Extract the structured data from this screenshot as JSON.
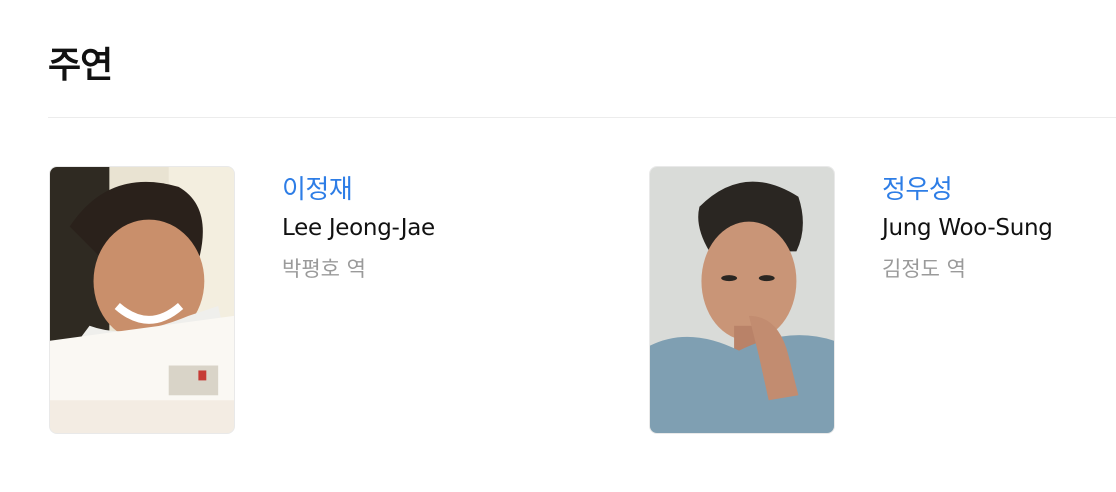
{
  "section": {
    "title": "주연"
  },
  "cast": [
    {
      "korean_name": "이정재",
      "english_name": "Lee Jeong-Jae",
      "role": "박평호 역"
    },
    {
      "korean_name": "정우성",
      "english_name": "Jung Woo-Sung",
      "role": "김정도 역"
    }
  ],
  "colors": {
    "link_blue": "#2d7de6",
    "text_dark": "#111111",
    "text_muted": "#9a9a9a",
    "divider": "#ececec"
  }
}
